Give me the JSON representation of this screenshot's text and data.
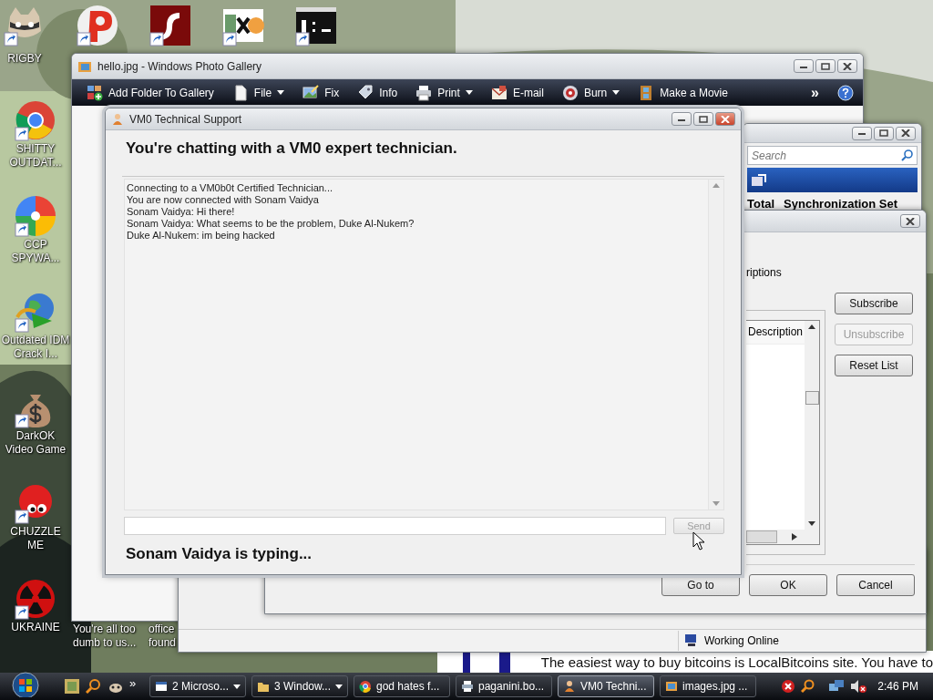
{
  "desktop": {
    "top_icons": [
      {
        "label": "RIGBY",
        "kind": "raccoon"
      },
      {
        "kind": "p-logo"
      },
      {
        "kind": "flash"
      },
      {
        "kind": "hxd"
      },
      {
        "kind": "console"
      }
    ],
    "left_icons": [
      {
        "label": "SHITTY OUTDAT...",
        "kind": "chrome"
      },
      {
        "label": "CCP SPYWA...",
        "kind": "pinwheel"
      },
      {
        "label": "Outdated IDM Crack I...",
        "kind": "globe"
      },
      {
        "label": "DarkOK Video Game",
        "kind": "moneybag"
      },
      {
        "label": "CHUZZLE ME",
        "kind": "fuzzball"
      },
      {
        "label": "UKRAINE",
        "kind": "radiation"
      }
    ],
    "bottom_icons": [
      {
        "label": "You're all too dumb to us..."
      },
      {
        "label": "office found"
      }
    ]
  },
  "photo_gallery": {
    "title": "hello.jpg - Windows Photo Gallery",
    "toolbar": [
      {
        "label": "Add Folder To Gallery",
        "kind": "add-folder",
        "dropdown": false
      },
      {
        "label": "File",
        "kind": "file",
        "dropdown": true
      },
      {
        "label": "Fix",
        "kind": "fix",
        "dropdown": false
      },
      {
        "label": "Info",
        "kind": "tag",
        "dropdown": false
      },
      {
        "label": "Print",
        "kind": "print",
        "dropdown": true
      },
      {
        "label": "E-mail",
        "kind": "mail",
        "dropdown": false
      },
      {
        "label": "Burn",
        "kind": "disc",
        "dropdown": true
      },
      {
        "label": "Make a Movie",
        "kind": "film",
        "dropdown": false
      }
    ],
    "overflow": "»"
  },
  "sync_window": {
    "search": {
      "placeholder": "Search"
    },
    "columns": [
      "Total",
      "Synchronization Set"
    ]
  },
  "dialog": {
    "section_label": "riptions",
    "list": {
      "columns": [
        "Description"
      ]
    },
    "side_buttons": [
      {
        "label": "Subscribe",
        "disabled": false
      },
      {
        "label": "Unsubscribe",
        "disabled": true
      },
      {
        "label": "Reset List",
        "disabled": false
      }
    ],
    "buttons": [
      {
        "label": "Go to"
      },
      {
        "label": "OK"
      },
      {
        "label": "Cancel"
      }
    ]
  },
  "status_window": {
    "status": "Working Online"
  },
  "web_page": {
    "text": "The easiest way to buy bitcoins is LocalBitcoins site. You have to"
  },
  "chat": {
    "title": "VM0 Technical Support",
    "heading": "You're chatting with a VM0 expert technician.",
    "log": [
      "Connecting to a VM0b0t Certified Technician...",
      "You are now connected with Sonam Vaidya",
      "Sonam Vaidya: Hi there!",
      "Sonam Vaidya: What seems to be the problem, Duke Al-Nukem?",
      "Duke Al-Nukem: im being hacked"
    ],
    "send": {
      "label": "Send",
      "disabled": true
    },
    "typing": "Sonam Vaidya is typing..."
  },
  "taskbar": {
    "quick_launch_more": "»",
    "tasks": [
      {
        "label": "2 Microso...",
        "kind": "window",
        "dropdown": true,
        "selected": false
      },
      {
        "label": "3 Window...",
        "kind": "folder",
        "dropdown": true,
        "selected": false
      },
      {
        "label": "god hates f...",
        "kind": "chrome",
        "dropdown": false,
        "selected": false
      },
      {
        "label": "paganini.bo...",
        "kind": "print",
        "dropdown": false,
        "selected": false
      },
      {
        "label": "VM0 Techni...",
        "kind": "person",
        "dropdown": false,
        "selected": true
      },
      {
        "label": "images.jpg ...",
        "kind": "gallery",
        "dropdown": false,
        "selected": false
      }
    ],
    "clock": "2:46 PM"
  }
}
